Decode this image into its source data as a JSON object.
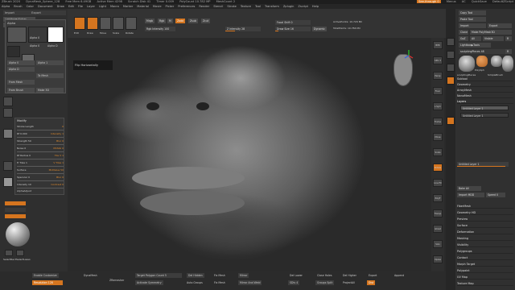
{
  "titlebar": {
    "app": "ZBrush 2020",
    "document": "DynaMesh_Sphere_128",
    "free_mem": "Free Mem 6.49GB",
    "active_mem": "Active Mem 4298",
    "scratch": "Scratch Disk 41",
    "timer": "Timer 0.009",
    "polycount": "PolyCount 10.782 MP",
    "meshcount": "MeshCount 2",
    "see_through": "See-through 0",
    "ac": "AC",
    "quicksave": "QuickSave",
    "menus_label": "Menus",
    "script": "DefaultZScript"
  },
  "menubar": [
    "Alpha",
    "Brush",
    "Color",
    "Document",
    "Draw",
    "Edit",
    "File",
    "Layer",
    "Light",
    "Macro",
    "Marker",
    "Material",
    "Movie",
    "Picker",
    "Preferences",
    "Render",
    "Stencil",
    "Stroke",
    "Texture",
    "Tool",
    "Transform",
    "Zplugin",
    "Zscript",
    "Help"
  ],
  "leftpanel": {
    "import": "Import",
    "export": "Export",
    "lightbox_alphas": "Lightbox▶Alphas",
    "brush_alpha": "BrushAlpha 84",
    "alpha_title": "Alpha",
    "alpha_labels": [
      "Alpha 0",
      "Alpha 0",
      "Alpha D"
    ],
    "alpha_btns": [
      "Alpha 0",
      "Alpha 1",
      "Alpha D"
    ],
    "from_mesh": "To Mesh",
    "from_brush": "From Mesh",
    "from_brush2": "From Brush",
    "make_3d": "Make 3D"
  },
  "modify": {
    "title": "Modify",
    "rows": [
      {
        "l": "Stroke Length",
        "r": "0"
      },
      {
        "l": "Rf 0.000",
        "r": "Intensity 1"
      },
      {
        "l": "Strength 50",
        "r": "Blur 0"
      },
      {
        "l": "Noise 0",
        "r": "MidVal 0"
      },
      {
        "l": "Rf Radius 0",
        "r": "Tile V 1"
      },
      {
        "l": "H Tiles 1",
        "r": "V Tiles 1"
      },
      {
        "l": "Surface",
        "r": "MidValue 50"
      },
      {
        "l": "Specular 0",
        "r": "Blur 0"
      },
      {
        "l": "Intensity 10",
        "r": "Contrast 0"
      }
    ],
    "alpha_adjust": "AlphaAdjust"
  },
  "topbar": {
    "edit": "Edit",
    "draw": "Draw",
    "move": "Move",
    "scale": "Scale",
    "rotate": "Rotate",
    "mrgb": "Mrgb",
    "rgb": "Rgb",
    "m": "M",
    "zadd": "Zadd",
    "zsub": "Zsub",
    "zcut": "Zcut",
    "rgb_intensity": "Rgb Intensity 100",
    "z_intensity": "Z Intensity 28",
    "focal_shift": "Focal Shift 0",
    "draw_size": "Draw Size 16",
    "dynamic": "Dynamic",
    "active_points": "ActivePoints: 10.729 Mil",
    "total_points": "TotalPoints: 10.784 Mil"
  },
  "viewport": {
    "tooltip": "Flip Horizontally"
  },
  "rightstrip": [
    "BPR",
    "SPix 3",
    "Persp",
    "Floor",
    "L.Sym",
    "Frame",
    "Move",
    "Scale",
    "Rotate",
    "Line Fill",
    "PolyF",
    "Transp",
    "Ghost",
    "Solo",
    "Xpose"
  ],
  "rightpanel": {
    "copy_tool": "Copy Tool",
    "paste_tool": "Paste Tool",
    "import": "Import",
    "export": "Export",
    "clone": "Clone",
    "make_polymesh": "Make PolyMesh3D",
    "goz": "GoZ",
    "all": "All",
    "visible": "Visible",
    "r": "R",
    "lightbox_tools": "Lightbox▶Tools",
    "sculpting_pieces": "sculptingPieces 48",
    "r2": "R",
    "tool_names": [
      "sculptingPieces",
      "PolySph",
      "SimpleBrush",
      "sculptingPieces"
    ],
    "items": [
      "Subtool",
      "Geometry",
      "ArrayMesh",
      "NanoMesh",
      "Layers"
    ],
    "layers": [
      "Untitled Layer 1",
      "Untitled Layer 1"
    ],
    "layer_slider": "Untitled Layer 1",
    "bake_all": "Bake All",
    "import_mdd": "Import MDD",
    "speed": "Speed 0",
    "items2": [
      "FiberMesh",
      "Geometry HD",
      "Preview",
      "Surface",
      "Deformation",
      "Masking",
      "Visibility",
      "Polygroups",
      "Contact",
      "Morph Target",
      "Polypaint",
      "UV Map",
      "Texture Map"
    ]
  },
  "bottombar": {
    "enable_customize": "Enable Customize",
    "resolution": "Resolution 128",
    "dynamesh": "DynaMesh",
    "zremesher": "ZRemesher",
    "target_polycount": "Target Polygon Count 5",
    "activate_symmetry": "Activate Symmetry",
    "auto_groups": "Auto Groups",
    "del_hidden": "Del Hidden",
    "fix_mesh": "Fix Mesh",
    "close_holes": "Close Holes",
    "groups_split": "Groups Split",
    "mirror": "Mirror",
    "mirror_and_weld": "Mirror And Weld",
    "sdiv": "SDiv 4",
    "del_lower": "Del Lower",
    "del_higher": "Del Higher",
    "project_all": "ProjectAll",
    "export": "Export",
    "append": "Append",
    "dist": "Dist",
    "select_rect": "SelectRect",
    "select_lasso": "SelectLasso",
    "gizmo": "Gizmo 3D",
    "zbr": "ZBr"
  }
}
